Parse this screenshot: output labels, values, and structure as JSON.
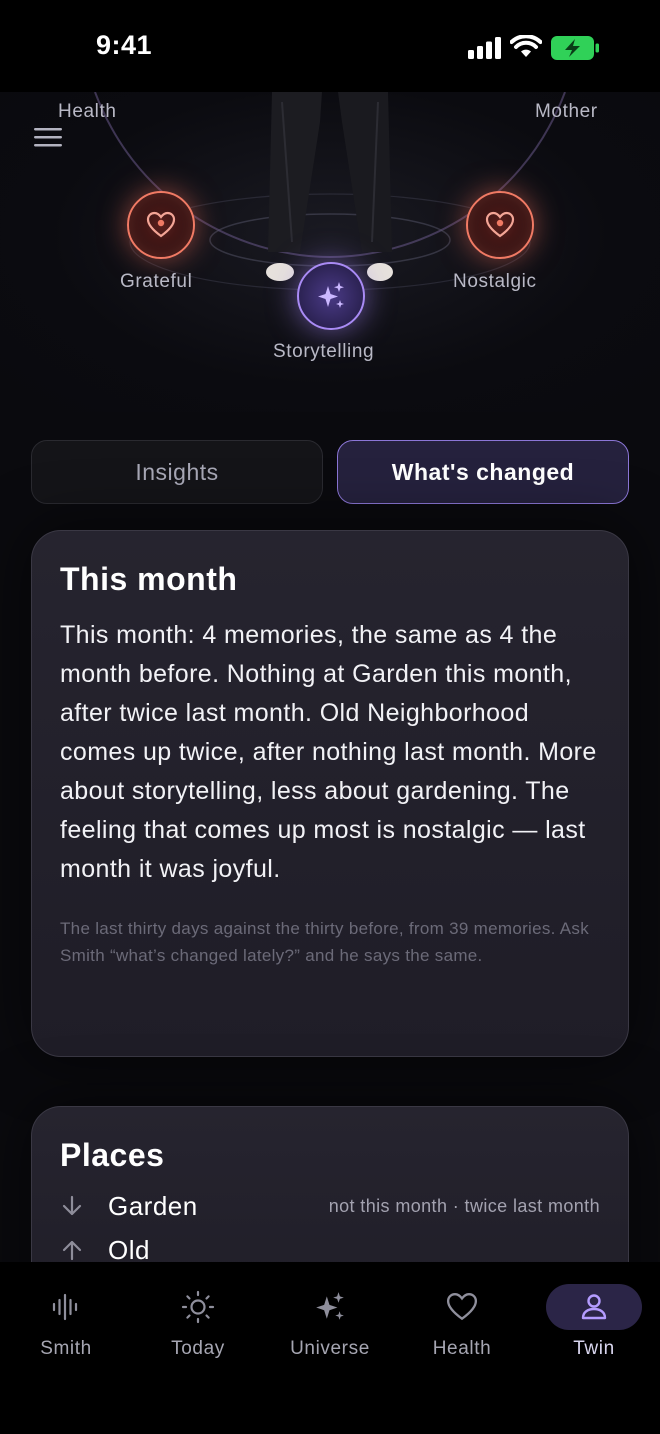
{
  "status_bar": {
    "time": "9:41"
  },
  "hero": {
    "top_left_label": "Health",
    "top_right_label": "Mother",
    "nodes": [
      {
        "label": "Grateful",
        "icon": "heart-icon"
      },
      {
        "label": "Nostalgic",
        "icon": "heart-icon"
      },
      {
        "label": "Storytelling",
        "icon": "sparkles-icon"
      }
    ]
  },
  "tabs": [
    {
      "label": "Insights",
      "selected": false
    },
    {
      "label": "What's changed",
      "selected": true
    }
  ],
  "month_card": {
    "title": "This month",
    "body": "This month: 4 memories, the same as 4 the month before. Nothing at Garden this month, after twice last month. Old Neighborhood comes up twice, after nothing last month. More about storytelling, less about gardening. The feeling that comes up most is nostalgic — last month it was joyful.",
    "footnote": "The last thirty days against the thirty before, from 39 memories. Ask Smith “what’s changed lately?” and he says the same."
  },
  "places_card": {
    "title": "Places",
    "rows": [
      {
        "trend": "down",
        "name": "Garden",
        "detail": "not this month · twice last month"
      },
      {
        "trend": "up",
        "name": "Old",
        "detail": ""
      }
    ]
  },
  "bottom_nav": [
    {
      "label": "Smith",
      "icon": "waveform-icon",
      "active": false
    },
    {
      "label": "Today",
      "icon": "sun-icon",
      "active": false
    },
    {
      "label": "Universe",
      "icon": "sparkles-icon",
      "active": false
    },
    {
      "label": "Health",
      "icon": "heart-icon",
      "active": false
    },
    {
      "label": "Twin",
      "icon": "person-icon",
      "active": true
    }
  ],
  "colors": {
    "accent": "#8b76d6",
    "emotion": "#f07a64",
    "background": "#0a0a0e",
    "card": "#24222c"
  }
}
